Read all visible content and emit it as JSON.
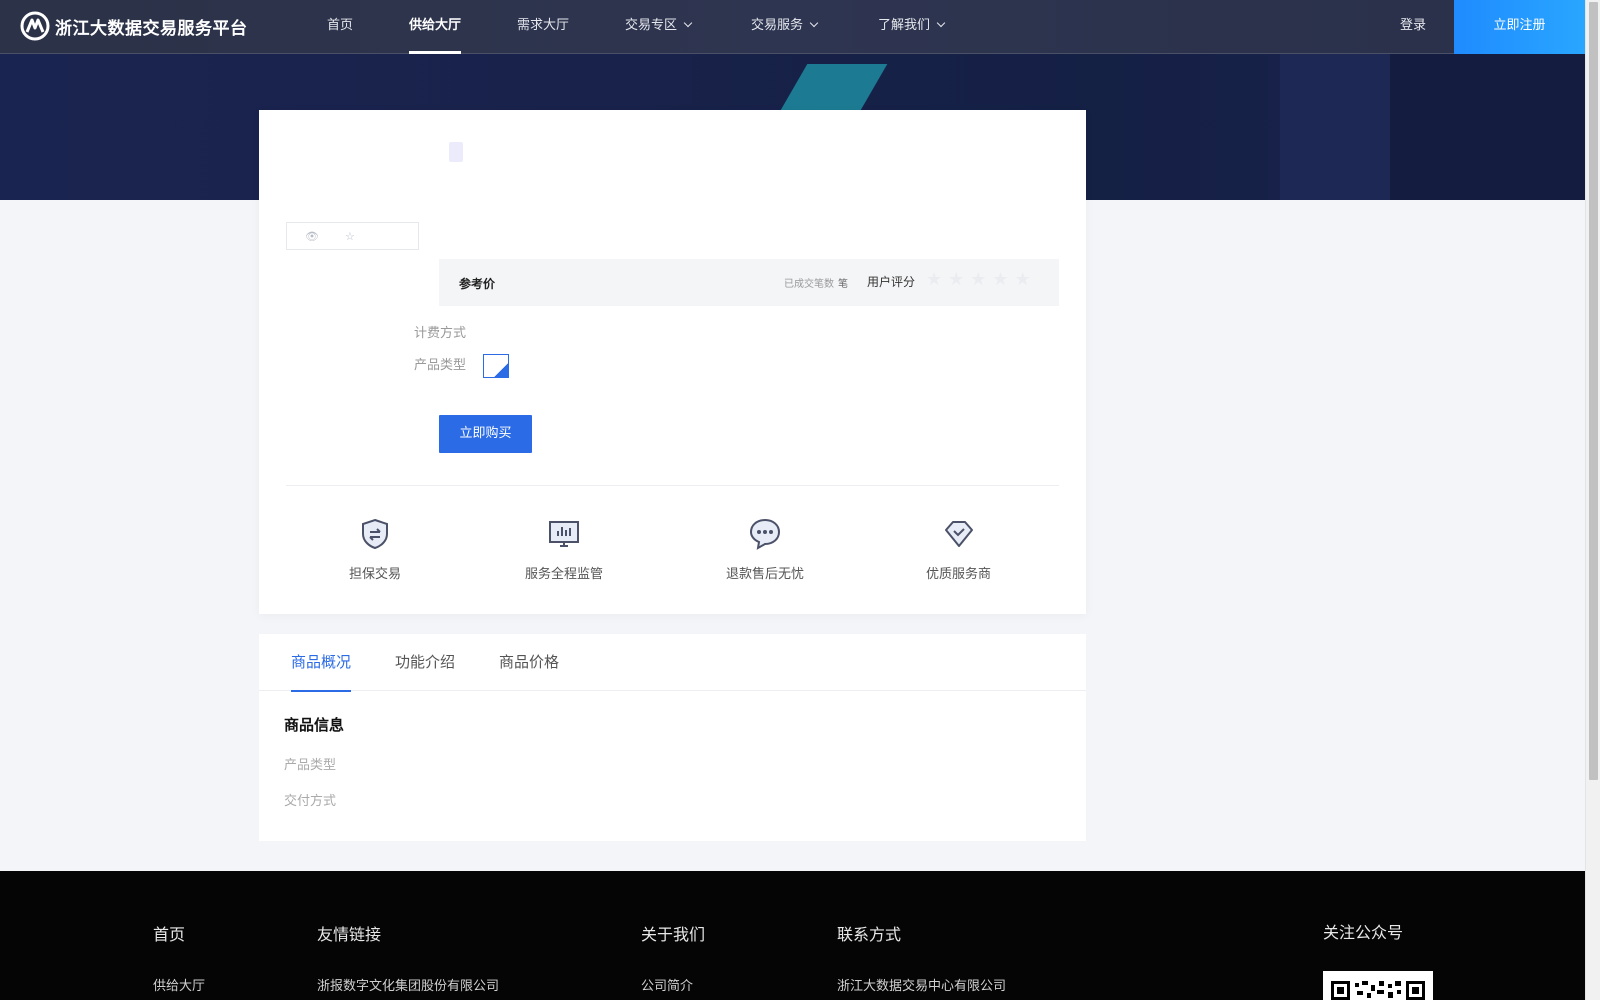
{
  "header": {
    "brand": "浙江大数据交易服务平台",
    "nav": [
      {
        "label": "首页"
      },
      {
        "label": "供给大厅",
        "active": true
      },
      {
        "label": "需求大厅"
      },
      {
        "label": "交易专区"
      },
      {
        "label": "交易服务"
      },
      {
        "label": "了解我们"
      }
    ],
    "login": "登录",
    "register": "立即注册"
  },
  "product": {
    "price_label": "参考价",
    "deals_label": "已成交笔数",
    "deals_unit": "笔",
    "rating_label": "用户评分",
    "rating_stars": 0,
    "billing_label": "计费方式",
    "type_label": "产品类型",
    "buy_button": "立即购买"
  },
  "features": [
    {
      "label": "担保交易",
      "icon": "shield-exchange-icon"
    },
    {
      "label": "服务全程监管",
      "icon": "monitor-chart-icon"
    },
    {
      "label": "退款售后无忧",
      "icon": "chat-bubble-icon"
    },
    {
      "label": "优质服务商",
      "icon": "diamond-check-icon"
    }
  ],
  "tabs": [
    {
      "label": "商品概况",
      "active": true
    },
    {
      "label": "功能介绍"
    },
    {
      "label": "商品价格"
    }
  ],
  "info": {
    "title": "商品信息",
    "type_label": "产品类型",
    "delivery_label": "交付方式"
  },
  "footer": {
    "headings": [
      "首页",
      "友情链接",
      "关于我们",
      "联系方式",
      "关注公众号"
    ],
    "links": [
      "供给大厅",
      "浙报数字文化集团股份有限公司",
      "公司简介",
      "浙江大数据交易中心有限公司"
    ]
  },
  "colors": {
    "accent": "#2b6be6",
    "header_bg": "#2c3247",
    "banner_bg": "#18224a",
    "footer_bg": "#050505"
  }
}
